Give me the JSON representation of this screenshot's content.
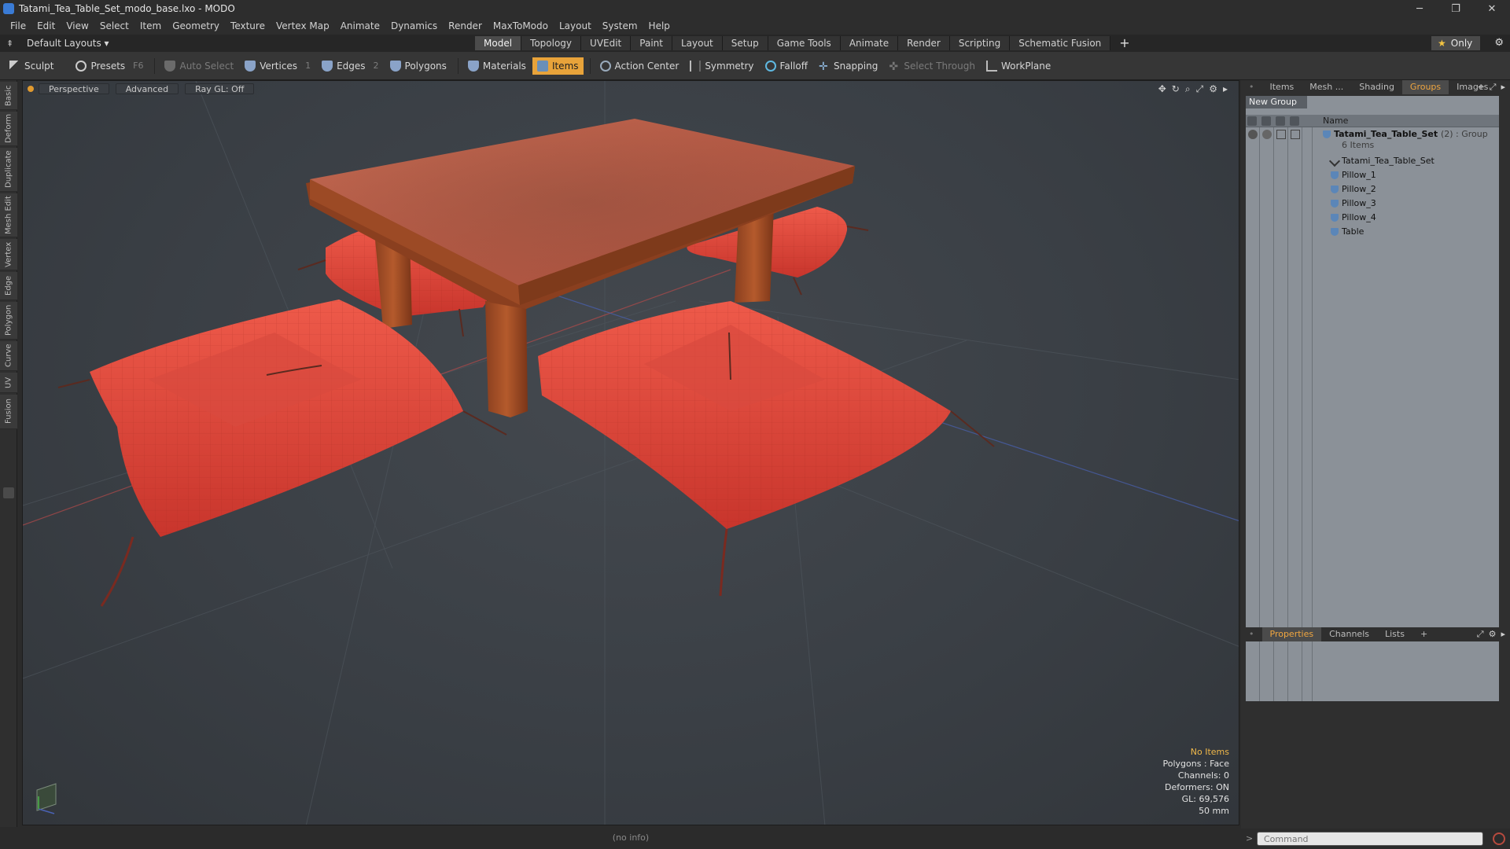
{
  "window": {
    "title": "Tatami_Tea_Table_Set_modo_base.lxo - MODO",
    "minimize": "─",
    "maximize": "❐",
    "close": "✕"
  },
  "menu": [
    "File",
    "Edit",
    "View",
    "Select",
    "Item",
    "Geometry",
    "Texture",
    "Vertex Map",
    "Animate",
    "Dynamics",
    "Render",
    "MaxToModo",
    "Layout",
    "System",
    "Help"
  ],
  "layoutbar": {
    "layout_label": "Default Layouts ▾",
    "tabs": [
      "Model",
      "Topology",
      "UVEdit",
      "Paint",
      "Layout",
      "Setup",
      "Game Tools",
      "Animate",
      "Render",
      "Scripting",
      "Schematic Fusion"
    ],
    "active_tab": "Model",
    "add_tab": "+",
    "only_label": "Only",
    "star": "★",
    "gear": "⚙"
  },
  "toolbar": {
    "sculpt": "Sculpt",
    "presets": "Presets",
    "presets_key": "F6",
    "auto_select": "Auto Select",
    "vertices": "Vertices",
    "vertices_key": "1",
    "edges": "Edges",
    "edges_key": "2",
    "polygons": "Polygons",
    "materials": "Materials",
    "items": "Items",
    "action_center": "Action Center",
    "symmetry": "Symmetry",
    "falloff": "Falloff",
    "snapping": "Snapping",
    "select_through": "Select Through",
    "workplane": "WorkPlane"
  },
  "left_tabs": [
    "Basic",
    "Deform",
    "Duplicate",
    "Mesh Edit",
    "Vertex",
    "Edge",
    "Polygon",
    "Curve",
    "UV",
    "Fusion"
  ],
  "viewport": {
    "view_mode": "Perspective",
    "shading": "Advanced",
    "raygl": "Ray GL: Off",
    "info": {
      "selection": "No Items",
      "polygons": "Polygons : Face",
      "channels": "Channels: 0",
      "deformers": "Deformers: ON",
      "gl": "GL: 69,576",
      "lens": "50 mm"
    }
  },
  "status_text": "(no info)",
  "right_panel": {
    "top_tabs": [
      "Items",
      "Mesh ...",
      "Shading",
      "Groups",
      "Images"
    ],
    "active_top_tab": "Groups",
    "new_group": "New Group",
    "column_name": "Name",
    "group": {
      "name": "Tatami_Tea_Table_Set",
      "suffix": "(2) : Group",
      "count": "6 Items",
      "children": [
        "Tatami_Tea_Table_Set",
        "Pillow_1",
        "Pillow_2",
        "Pillow_3",
        "Pillow_4",
        "Table"
      ]
    },
    "bottom_tabs": [
      "Properties",
      "Channels",
      "Lists"
    ],
    "active_bottom_tab": "Properties",
    "add_tab": "+",
    "command_placeholder": "Command",
    "command_prompt": ">"
  },
  "colors": {
    "accent_orange": "#e8a33a",
    "pillow_red": "#e0443a",
    "table_wood": "#a8532c",
    "table_top": "#c9694f"
  }
}
